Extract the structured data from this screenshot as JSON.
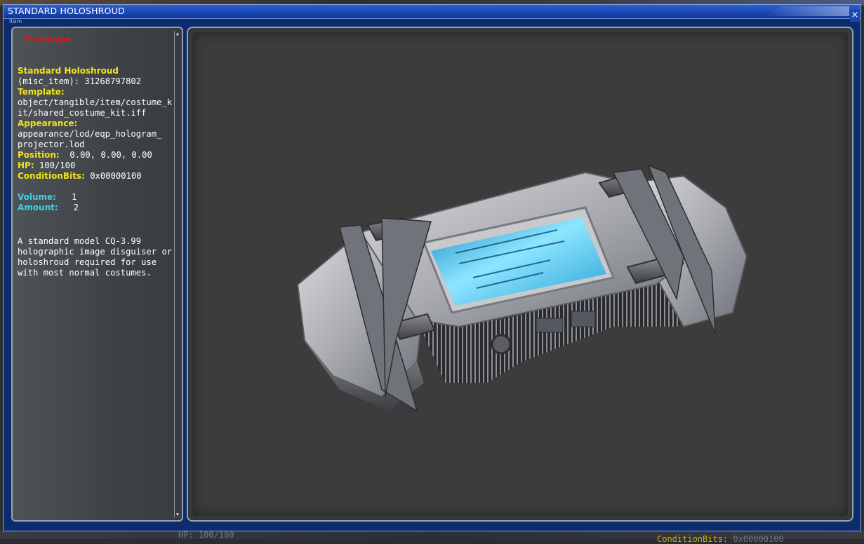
{
  "window": {
    "title": "STANDARD HOLOSHROUD",
    "title_sub": "Item",
    "close_label": "×"
  },
  "info": {
    "tag": "Prototype",
    "name": "Standard Holoshroud",
    "object_line": "(misc_item): 31268797802",
    "template_label": "Template:",
    "template_value_1": "object/tangible/item/costume_k",
    "template_value_2": "it/shared_costume_kit.iff",
    "appearance_label": "Appearance:",
    "appearance_value_1": "appearance/lod/eqp_hologram_",
    "appearance_value_2": "projector.lod",
    "position_label": "Position:",
    "position_value": "0.00, 0.00, 0.00",
    "hp_label": "HP:",
    "hp_value": "100/100",
    "condition_label": "ConditionBits:",
    "condition_value": "0x00000100",
    "volume_label": "Volume:",
    "volume_value": "1",
    "amount_label": "Amount:",
    "amount_value": "2",
    "description_1": "A standard model CQ-3.99",
    "description_2": "holographic image disguiser or",
    "description_3": "holoshroud required for use",
    "description_4": "with most normal costumes."
  },
  "background": {
    "hp_ghost": "HP: 100/100",
    "condition_ghost_label": "ConditionBits:",
    "condition_ghost_value": "0x00000100"
  },
  "colors": {
    "titlebar": "#1a46b0",
    "label_yellow": "#f2e21a",
    "label_cyan": "#38d4e6",
    "prototype_red": "#e11414",
    "screen_cyan": "#3fc4ec"
  },
  "icons": {
    "close": "close-icon",
    "scroll_up": "arrow-up-icon",
    "scroll_down": "arrow-down-icon"
  }
}
